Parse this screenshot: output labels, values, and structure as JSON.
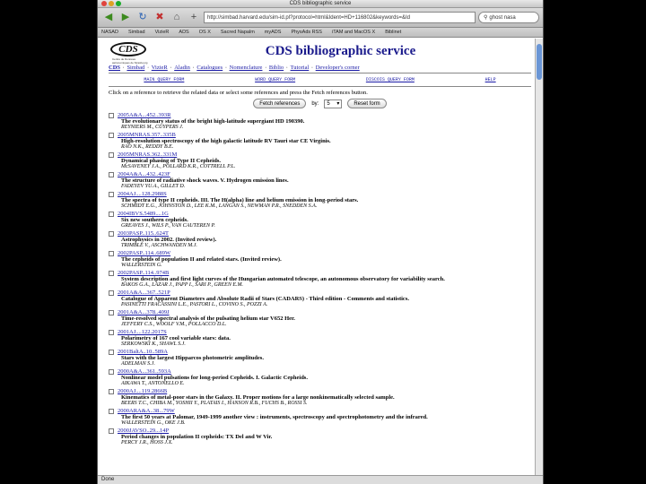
{
  "window": {
    "title": "CDS bibliographic service"
  },
  "toolbar": {
    "url": "http://simbad.harvard.edu/sim-id.pl?protocol=html&Ident=HD+116802&keywords=&Id",
    "search_value": "ghost nasa"
  },
  "bookmarks": [
    "NASAD",
    "Simbad",
    "VizieR",
    "ADS",
    "OS X",
    "Sacred Napalm",
    "myADS",
    "PhysAds RSS",
    "iTAM and MacOS X",
    "Biblinet"
  ],
  "page": {
    "logo_text": "CDS",
    "logo_sub": "Centre de Données astronomiques de Strasbourg",
    "title": "CDS bibliographic service",
    "nav": [
      "CDS",
      "Simbad",
      "VizieR",
      "Aladin",
      "Catalogues",
      "Nomenclature",
      "Biblio",
      "Tutorial",
      "Developer's corner"
    ],
    "query_forms": [
      "MAIN QUERY FORM",
      "WORD QUERY FORM",
      "DISCOIS QUERY FORM",
      "HELP"
    ],
    "instructions": "Click on a reference to retrieve the related data or select some references and press the Fetch references button.",
    "fetch_button": "Fetch references",
    "by_label": "by:",
    "by_value": "5",
    "reset_button": "Reset form"
  },
  "references": [
    {
      "bibcode": "2005A&A...452..393R",
      "title": "The evolutionary status of the bright high-latitude supergiant HD 190390.",
      "authors": "REYNIERS M., CUYPERS J."
    },
    {
      "bibcode": "2005MNRAS.357..335B",
      "title": "High-resolution spectroscopy of the high galactic latitude RV Tauri star CE Virginis.",
      "authors": "RAO N.K., REDDY B.E."
    },
    {
      "bibcode": "2005MNRAS.362..331M",
      "title": "Dynamical phasing of Type II Cepheids.",
      "authors": "McSAVENEY J.A., POLLARD K.R., COTTRELL P.L."
    },
    {
      "bibcode": "2004A&A...432..423F",
      "title": "The structure of radiative shock waves. V. Hydrogen emission lines.",
      "authors": "FADEYEV YU.A., GILLET D."
    },
    {
      "bibcode": "2004AJ....128.2988S",
      "title": "The spectra of type II cepheids. III. The H(alpha) line and helium emission in long-period stars.",
      "authors": "SCHMIDT E.G., JOHNSTON D., LEE K.M., LANGAN S., NEWMAN P.R., SNEDDEN S.A."
    },
    {
      "bibcode": "2004IBVS.5489....1G",
      "title": "Six new southern cepheids.",
      "authors": "GREAVES J., WILS P., VAN CAUTEREN P."
    },
    {
      "bibcode": "2003PASP..115..624T",
      "title": "Astrophysics in 2002. (Invited review).",
      "authors": "TRIMBLE V., ASCHWANDEN M.J."
    },
    {
      "bibcode": "2002PASP..114..689W",
      "title": "The cepheids of population II and related stars. (Invited review).",
      "authors": "WALLERSTEIN G."
    },
    {
      "bibcode": "2002PASP..114..974B",
      "title": "System description and first light curves of the Hungarian automated telescope, an autonomous observatory for variability search.",
      "authors": "BAKOS G.A., LAZAR J., PAPP I., SARI P., GREEN E.M."
    },
    {
      "bibcode": "2001A&A...367..521P",
      "title": "Catalogue of Apparent Diameters and Absolute Radii of Stars (CADARS) - Third edition - Comments and statistics.",
      "authors": "PASINETTI FRACASSINI L.E., PASTORI L., COVINO S., POZZI A."
    },
    {
      "bibcode": "2001A&A...378..409J",
      "title": "Time-resolved spectral analysis of the pulsating helium star V652 Her.",
      "authors": "JEFFERY C.S., WOOLF V.M., POLLACCO D.L."
    },
    {
      "bibcode": "2001AJ....122.2017S",
      "title": "Polarimetry of 167 cool variable stars: data.",
      "authors": "SERKOWSKI K., SHAWL S.J."
    },
    {
      "bibcode": "2001BaltA..10..589A",
      "title": "Stars with the largest Hipparcos photometric amplitudes.",
      "authors": "ADELMAN S.J."
    },
    {
      "bibcode": "2000A&A...361..593A",
      "title": "Nonlinear model pulsations for long-period Cepheids. I. Galactic Cepheids.",
      "authors": "AIKAWA T., ANTONELLO E."
    },
    {
      "bibcode": "2000AJ....119.2866B",
      "title": "Kinematics of metal-poor stars in the Galaxy. II. Proper motions for a large nonkinematically selected sample.",
      "authors": "BEERS T.C., CHIBA M., YOSHII Y., PLATAIS I., HANSON R.B., FUCHS B., ROSSI S."
    },
    {
      "bibcode": "2000ARA&A..38...79W",
      "title": "The first 50 years at Palomar, 1949-1999 another view : instruments, spectroscopy and spectrophotometry and the infrared.",
      "authors": "WALLERSTEIN G., OKE J.B."
    },
    {
      "bibcode": "2000JAVSO..29...14P",
      "title": "Period changes in population II cepheids: TX Del and W Vir.",
      "authors": "PERCY J.R., HOSS J.X."
    }
  ],
  "status": "Done"
}
